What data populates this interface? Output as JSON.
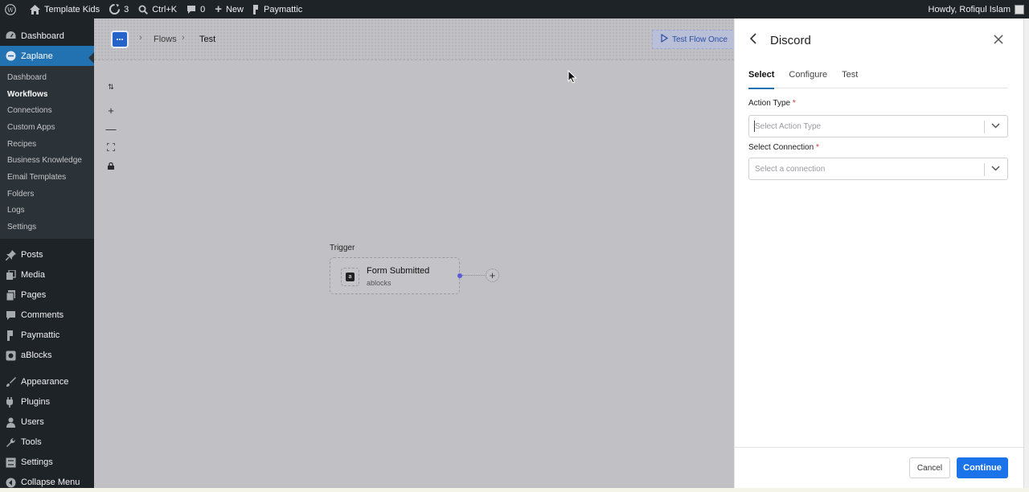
{
  "adminbar": {
    "site_name": "Template Kids",
    "updates_count": "3",
    "search_shortcut": "Ctrl+K",
    "comments_count": "0",
    "new_label": "New",
    "plugin_label": "Paymattic",
    "howdy": "Howdy, Rofiqul Islam"
  },
  "sidebar": {
    "dashboard": "Dashboard",
    "zaplane": "Zaplane",
    "submenu": [
      "Dashboard",
      "Workflows",
      "Connections",
      "Custom Apps",
      "Recipes",
      "Business Knowledge",
      "Email Templates",
      "Folders",
      "Logs",
      "Settings"
    ],
    "current_submenu": "Workflows",
    "posts": "Posts",
    "media": "Media",
    "pages": "Pages",
    "comments": "Comments",
    "paymattic": "Paymattic",
    "ablocks": "aBlocks",
    "appearance": "Appearance",
    "plugins": "Plugins",
    "users": "Users",
    "tools": "Tools",
    "settings": "Settings",
    "collapse": "Collapse Menu"
  },
  "canvas": {
    "breadcrumb_flows": "Flows",
    "breadcrumb_test": "Test",
    "test_flow_button": "Test Flow Once",
    "trigger_label": "Trigger",
    "trigger_node_title": "Form Submitted",
    "trigger_node_subtitle": "ablocks"
  },
  "panel": {
    "title": "Discord",
    "tabs": [
      "Select",
      "Configure",
      "Test"
    ],
    "active_tab": "Select",
    "action_type_label": "Action Type",
    "action_type_placeholder": "Select Action Type",
    "connection_label": "Select Connection",
    "connection_placeholder": "Select a connection",
    "required_mark": "*",
    "cancel_label": "Cancel",
    "continue_label": "Continue"
  },
  "colors": {
    "accent": "#2271b1",
    "primary_button": "#1a73e8",
    "admin_dark": "#1d2327",
    "required": "#d63638"
  }
}
